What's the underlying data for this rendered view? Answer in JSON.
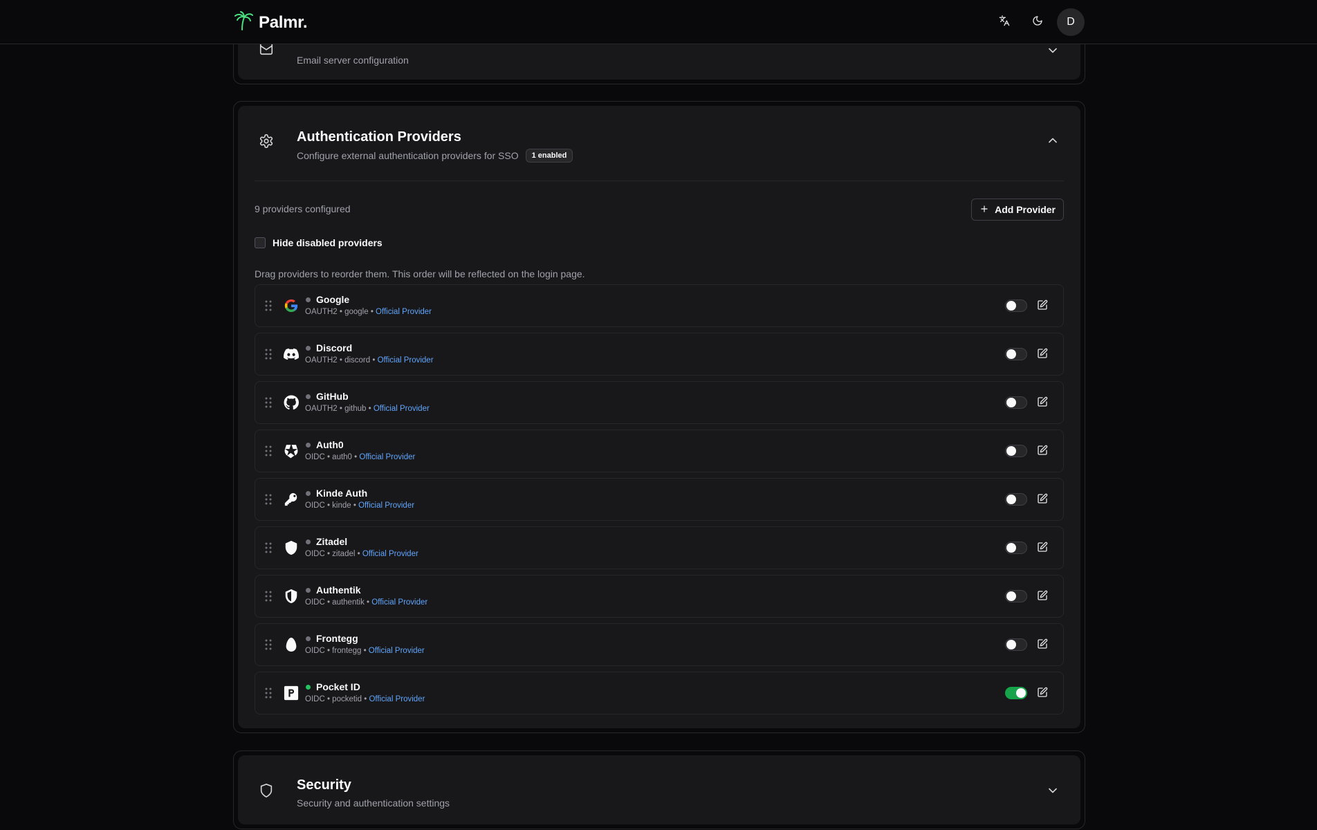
{
  "app": {
    "name": "Palmr.",
    "avatar_initial": "D"
  },
  "email_section": {
    "description": "Email server configuration"
  },
  "auth_section": {
    "title": "Authentication Providers",
    "description": "Configure external authentication providers for SSO",
    "badge": "1 enabled",
    "count_text": "9 providers configured",
    "add_button": "Add Provider",
    "hide_disabled_label": "Hide disabled providers",
    "drag_hint": "Drag providers to reorder them. This order will be reflected on the login page.",
    "providers": [
      {
        "name": "Google",
        "type": "OAUTH2",
        "id": "google",
        "tag": "Official Provider",
        "enabled": false,
        "icon": "google-icon"
      },
      {
        "name": "Discord",
        "type": "OAUTH2",
        "id": "discord",
        "tag": "Official Provider",
        "enabled": false,
        "icon": "discord-icon"
      },
      {
        "name": "GitHub",
        "type": "OAUTH2",
        "id": "github",
        "tag": "Official Provider",
        "enabled": false,
        "icon": "github-icon"
      },
      {
        "name": "Auth0",
        "type": "OIDC",
        "id": "auth0",
        "tag": "Official Provider",
        "enabled": false,
        "icon": "auth0-icon"
      },
      {
        "name": "Kinde Auth",
        "type": "OIDC",
        "id": "kinde",
        "tag": "Official Provider",
        "enabled": false,
        "icon": "key-icon"
      },
      {
        "name": "Zitadel",
        "type": "OIDC",
        "id": "zitadel",
        "tag": "Official Provider",
        "enabled": false,
        "icon": "shield-icon"
      },
      {
        "name": "Authentik",
        "type": "OIDC",
        "id": "authentik",
        "tag": "Official Provider",
        "enabled": false,
        "icon": "authentik-icon"
      },
      {
        "name": "Frontegg",
        "type": "OIDC",
        "id": "frontegg",
        "tag": "Official Provider",
        "enabled": false,
        "icon": "frontegg-icon"
      },
      {
        "name": "Pocket ID",
        "type": "OIDC",
        "id": "pocketid",
        "tag": "Official Provider",
        "enabled": true,
        "icon": "pocketid-icon"
      }
    ]
  },
  "security_section": {
    "title": "Security",
    "description": "Security and authentication settings"
  },
  "colors": {
    "accent_enabled": "#16a34a",
    "link": "#60a5fa",
    "background": "#09090b",
    "card": "#18181b"
  }
}
